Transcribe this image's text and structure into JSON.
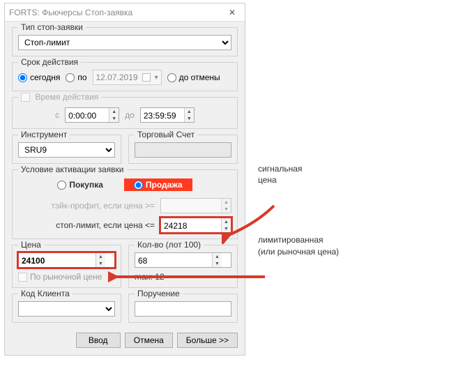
{
  "window": {
    "title": "FORTS: Фьючерсы Стоп-заявка"
  },
  "stopType": {
    "label": "Тип стоп-заявки",
    "value": "Стоп-лимит"
  },
  "validity": {
    "label": "Срок действия",
    "today": "сегодня",
    "until": "по",
    "date": "12.07.2019",
    "cancel": "до отмены",
    "selected": "today"
  },
  "timeAction": {
    "label": "Время действия",
    "fromLabel": "с",
    "from": "0:00:00",
    "toLabel": "до",
    "to": "23:59:59"
  },
  "instrument": {
    "label": "Инструмент",
    "value": "SRU9"
  },
  "account": {
    "label": "Торговый Счет",
    "value": ""
  },
  "activation": {
    "label": "Условие активации заявки",
    "buy": "Покупка",
    "sell": "Продажа",
    "selected": "sell",
    "tpLabel": "тэйк-профит, если цена >=",
    "tpValue": "",
    "slLabel": "стоп-лимит, если цена <=",
    "slValue": "24218"
  },
  "price": {
    "label": "Цена",
    "value": "24100",
    "marketChk": "По рыночной цене"
  },
  "qty": {
    "label": "Кол-во (лот 100)",
    "value": "68",
    "maxLabel": "max: 12"
  },
  "clientCode": {
    "label": "Код Клиента",
    "value": ""
  },
  "instruction": {
    "label": "Поручение",
    "value": ""
  },
  "buttons": {
    "enter": "Ввод",
    "cancel": "Отмена",
    "more": "Больше >>"
  },
  "annotations": {
    "signal1": "сигнальная",
    "signal2": "цена",
    "limit1": "лимитированная",
    "limit2": "(или рыночная цена)"
  }
}
